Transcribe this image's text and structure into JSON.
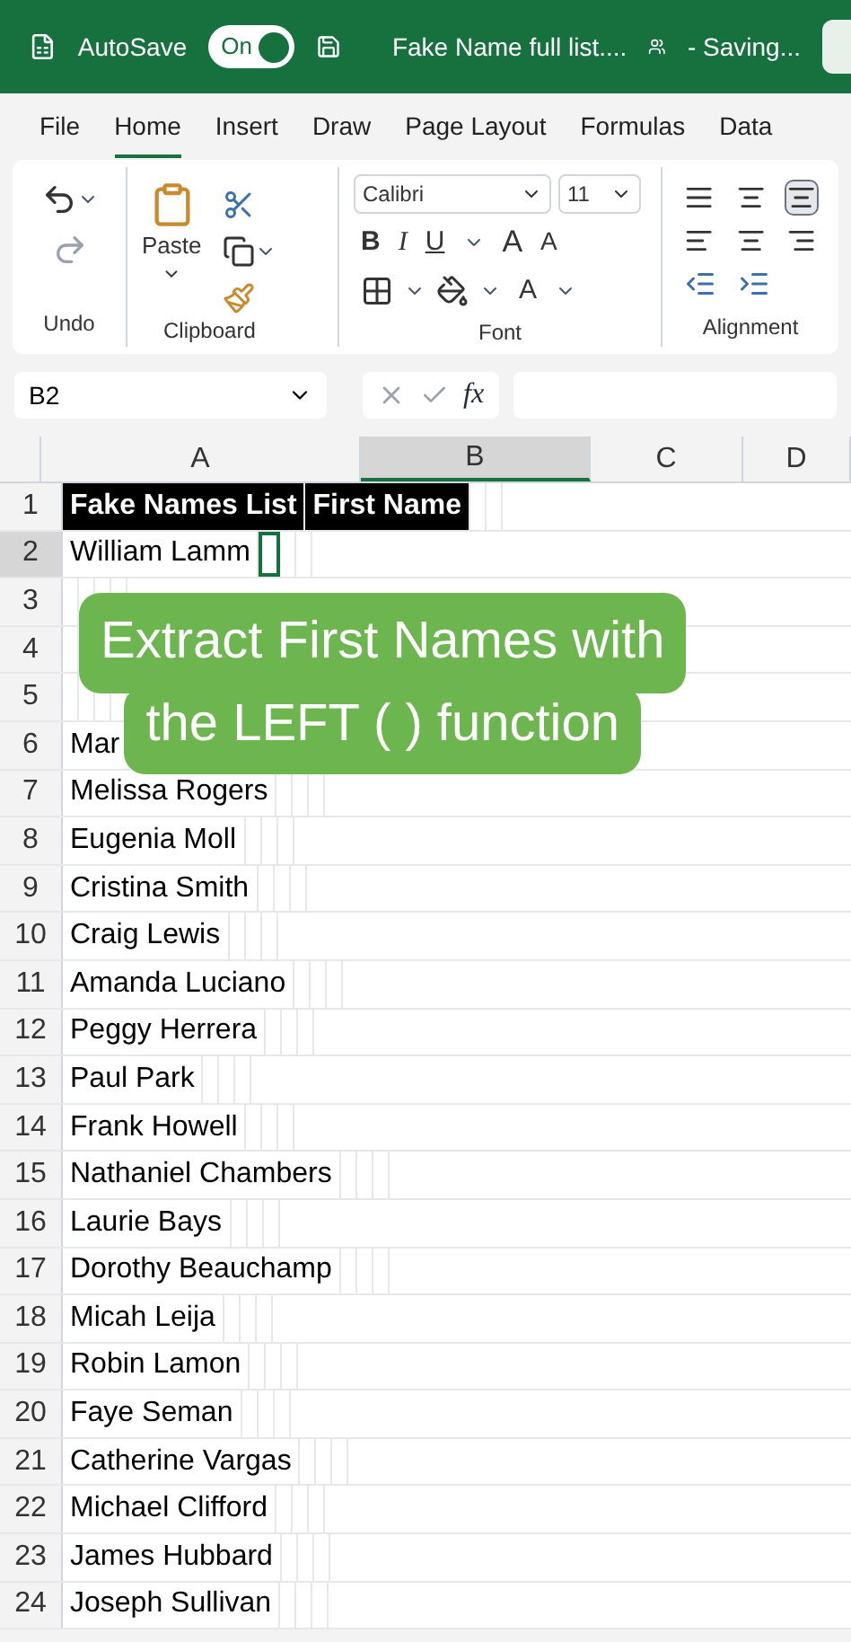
{
  "title_bar": {
    "autosave_label": "AutoSave",
    "autosave": {
      "on": true,
      "label": "On"
    },
    "title": "Fake Name full list....",
    "status": "- Saving..."
  },
  "ribbon_tabs": [
    {
      "label": "File",
      "selected": false
    },
    {
      "label": "Home",
      "selected": true
    },
    {
      "label": "Insert",
      "selected": false
    },
    {
      "label": "Draw",
      "selected": false
    },
    {
      "label": "Page Layout",
      "selected": false
    },
    {
      "label": "Formulas",
      "selected": false
    },
    {
      "label": "Data",
      "selected": false
    }
  ],
  "ribbon": {
    "groups": [
      "Undo",
      "Clipboard",
      "Font",
      "Alignment"
    ],
    "paste_label": "Paste",
    "font_name": "Calibri",
    "font_size": "11",
    "bold": "B",
    "italic": "I",
    "underline": "U",
    "grow_font": "A",
    "shrink_font": "A",
    "font_color": "A"
  },
  "formula_bar": {
    "name_box": "B2",
    "fx": "fx"
  },
  "columns": [
    {
      "label": "A",
      "selected": false
    },
    {
      "label": "B",
      "selected": true
    },
    {
      "label": "C",
      "selected": false
    },
    {
      "label": "D",
      "selected": false
    }
  ],
  "rows": [
    {
      "number": "1",
      "a": "Fake Names List",
      "b": "First Name",
      "header": true,
      "selected": false
    },
    {
      "number": "2",
      "a": "William Lamm",
      "header": false,
      "selected": true
    },
    {
      "number": "3",
      "header": false
    },
    {
      "number": "4",
      "header": false
    },
    {
      "number": "5",
      "header": false
    },
    {
      "number": "6",
      "a": "Mar",
      "header": false
    },
    {
      "number": "7",
      "a": "Melissa Rogers",
      "header": false
    },
    {
      "number": "8",
      "a": "Eugenia Moll",
      "header": false
    },
    {
      "number": "9",
      "a": "Cristina Smith",
      "header": false
    },
    {
      "number": "10",
      "a": "Craig Lewis",
      "header": false
    },
    {
      "number": "11",
      "a": "Amanda Luciano",
      "header": false
    },
    {
      "number": "12",
      "a": "Peggy Herrera",
      "header": false
    },
    {
      "number": "13",
      "a": "Paul Park",
      "header": false
    },
    {
      "number": "14",
      "a": "Frank Howell",
      "header": false
    },
    {
      "number": "15",
      "a": "Nathaniel Chambers",
      "header": false
    },
    {
      "number": "16",
      "a": "Laurie Bays",
      "header": false
    },
    {
      "number": "17",
      "a": "Dorothy Beauchamp",
      "header": false
    },
    {
      "number": "18",
      "a": "Micah Leija",
      "header": false
    },
    {
      "number": "19",
      "a": "Robin Lamon",
      "header": false
    },
    {
      "number": "20",
      "a": "Faye Seman",
      "header": false
    },
    {
      "number": "21",
      "a": "Catherine Vargas",
      "header": false
    },
    {
      "number": "22",
      "a": "Michael Clifford",
      "header": false
    },
    {
      "number": "23",
      "a": "James Hubbard",
      "header": false
    },
    {
      "number": "24",
      "a": "Joseph Sullivan",
      "header": false
    }
  ],
  "caption": [
    "Extract First Names with",
    "the LEFT ( ) function"
  ]
}
